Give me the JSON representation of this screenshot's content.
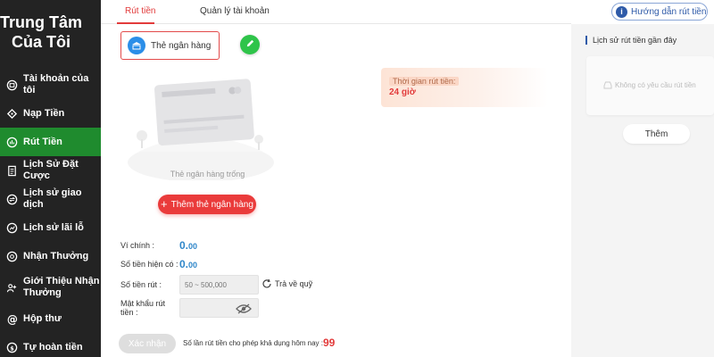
{
  "sidebar": {
    "brand_line1": "Trung Tâm",
    "brand_line2": "Của Tôi",
    "items": [
      {
        "label": "Tài khoản của tôi",
        "icon": "account-icon"
      },
      {
        "label": "Nạp Tiền",
        "icon": "deposit-icon"
      },
      {
        "label": "Rút Tiền",
        "icon": "withdraw-icon",
        "active": true
      },
      {
        "label": "Lịch Sử Đặt Cược",
        "icon": "bet-history-icon"
      },
      {
        "label": "Lịch sử giao dịch",
        "icon": "transaction-history-icon"
      },
      {
        "label": "Lịch sử lãi lỗ",
        "icon": "profit-loss-icon"
      },
      {
        "label": "Nhận Thưởng",
        "icon": "reward-icon"
      },
      {
        "label": "Giới Thiệu Nhận Thưởng",
        "icon": "referral-icon"
      },
      {
        "label": "Hộp thư",
        "icon": "mailbox-icon"
      },
      {
        "label": "Tự hoàn tiền",
        "icon": "cashback-icon"
      }
    ],
    "active_color": "#1f8b2e"
  },
  "tabs": [
    {
      "label": "Rút tiền",
      "active": true
    },
    {
      "label": "Quản lý tài khoản",
      "active": false
    }
  ],
  "guide_button": {
    "label": "Hướng dẫn rút tiền"
  },
  "bank": {
    "select_label": "Thẻ ngân hàng",
    "empty_text": "Thẻ ngân hàng trống",
    "add_button": "Thêm thẻ ngân hàng"
  },
  "withdraw_time": {
    "label": "Thời gian rút tiền:",
    "value": "24 giờ"
  },
  "form": {
    "main_wallet_label": "Ví chính :",
    "main_wallet_int": "0.",
    "main_wallet_dec": "00",
    "current_balance_label": "Số tiền hiện có :",
    "current_balance_int": "0.",
    "current_balance_dec": "00",
    "amount_label": "Số tiền rút :",
    "amount_placeholder": "50 ~ 500,000",
    "return_label": "Trả về quỹ",
    "password_label_1": "Mật khẩu rút",
    "password_label_2": "tiền :",
    "confirm_button": "Xác nhận",
    "quota_text": "Số lần rút tiền cho phép khả dụng hôm nay :",
    "quota_value": "99"
  },
  "history": {
    "title": "Lịch sử rút tiền gần đây",
    "empty_text": "Không có yêu cầu rút tiền",
    "more_button": "Thêm"
  },
  "colors": {
    "accent_red": "#e23b3b",
    "value_blue": "#2e86c9",
    "sidebar_bg": "#232323"
  }
}
